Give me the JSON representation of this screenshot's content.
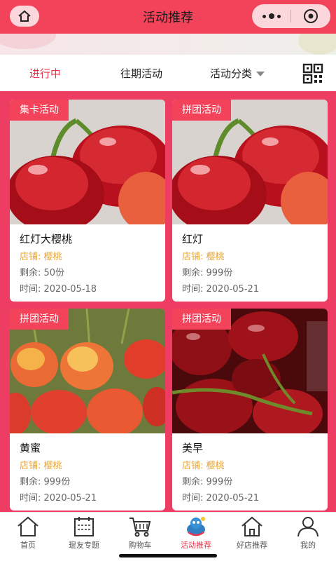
{
  "header": {
    "title": "活动推荐",
    "home_icon": "home-icon",
    "more_icon": "more-dots-icon",
    "target_icon": "target-icon"
  },
  "tabs": [
    {
      "label": "进行中",
      "active": true
    },
    {
      "label": "往期活动",
      "active": false
    },
    {
      "label": "活动分类",
      "active": false,
      "has_dropdown": true
    }
  ],
  "qr_icon": "qr-code-icon",
  "cards": [
    {
      "tag": "集卡活动",
      "name": "红灯大樱桃",
      "shop": "店铺: 樱桃",
      "remain": "剩余: 50份",
      "time": "时间: 2020-05-18",
      "image": "red-cherries"
    },
    {
      "tag": "拼团活动",
      "name": "红灯",
      "shop": "店铺: 樱桃",
      "remain": "剩余: 999份",
      "time": "时间: 2020-05-21",
      "image": "red-cherries"
    },
    {
      "tag": "拼团活动",
      "name": "黄蜜",
      "shop": "店铺: 樱桃",
      "remain": "剩余: 999份",
      "time": "时间: 2020-05-21",
      "image": "yellow-cherries"
    },
    {
      "tag": "拼团活动",
      "name": "美早",
      "shop": "店铺: 樱桃",
      "remain": "剩余: 999份",
      "time": "时间: 2020-05-21",
      "image": "dark-cherries"
    }
  ],
  "nav": [
    {
      "label": "首页",
      "icon": "home-icon",
      "active": false
    },
    {
      "label": "琨友专题",
      "icon": "calendar-icon",
      "active": false
    },
    {
      "label": "购物车",
      "icon": "cart-icon",
      "active": false
    },
    {
      "label": "活动推荐",
      "icon": "mascot-icon",
      "active": true
    },
    {
      "label": "好店推荐",
      "icon": "shop-icon",
      "active": false
    },
    {
      "label": "我的",
      "icon": "user-icon",
      "active": false
    }
  ],
  "colors": {
    "brand": "#f2435a",
    "content_bg": "#ee3d63",
    "shop_text": "#e8a634",
    "active_text": "#e8344a"
  }
}
